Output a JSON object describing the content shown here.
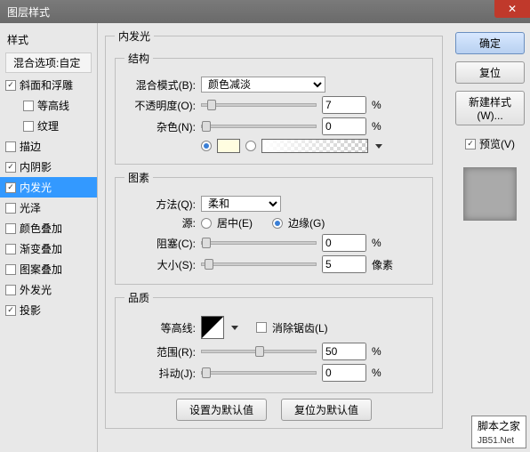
{
  "window": {
    "title": "图层样式"
  },
  "sidebar": {
    "heading": "样式",
    "subheading": "混合选项:自定",
    "items": [
      {
        "label": "斜面和浮雕",
        "checked": true,
        "indent": false
      },
      {
        "label": "等高线",
        "checked": false,
        "indent": true
      },
      {
        "label": "纹理",
        "checked": false,
        "indent": true
      },
      {
        "label": "描边",
        "checked": false,
        "indent": false
      },
      {
        "label": "内阴影",
        "checked": true,
        "indent": false
      },
      {
        "label": "内发光",
        "checked": true,
        "indent": false,
        "selected": true
      },
      {
        "label": "光泽",
        "checked": false,
        "indent": false
      },
      {
        "label": "颜色叠加",
        "checked": false,
        "indent": false
      },
      {
        "label": "渐变叠加",
        "checked": false,
        "indent": false
      },
      {
        "label": "图案叠加",
        "checked": false,
        "indent": false
      },
      {
        "label": "外发光",
        "checked": false,
        "indent": false
      },
      {
        "label": "投影",
        "checked": true,
        "indent": false
      }
    ]
  },
  "panel": {
    "title": "内发光",
    "struct": {
      "legend": "结构",
      "blend_label": "混合模式(B):",
      "blend_value": "颜色减淡",
      "opacity_label": "不透明度(O):",
      "opacity_value": "7",
      "opacity_unit": "%",
      "noise_label": "杂色(N):",
      "noise_value": "0",
      "noise_unit": "%"
    },
    "elements": {
      "legend": "图素",
      "method_label": "方法(Q):",
      "method_value": "柔和",
      "source_label": "源:",
      "source_center": "居中(E)",
      "source_edge": "边缘(G)",
      "choke_label": "阻塞(C):",
      "choke_value": "0",
      "choke_unit": "%",
      "size_label": "大小(S):",
      "size_value": "5",
      "size_unit": "像素"
    },
    "quality": {
      "legend": "品质",
      "contour_label": "等高线:",
      "antialias_label": "消除锯齿(L)",
      "range_label": "范围(R):",
      "range_value": "50",
      "range_unit": "%",
      "jitter_label": "抖动(J):",
      "jitter_value": "0",
      "jitter_unit": "%"
    },
    "buttons": {
      "default": "设置为默认值",
      "reset": "复位为默认值"
    }
  },
  "rightbar": {
    "ok": "确定",
    "cancel": "复位",
    "new_style": "新建样式(W)...",
    "preview_label": "预览(V)"
  },
  "watermark": {
    "line1": "脚本之家",
    "line2": "JB51.Net"
  }
}
